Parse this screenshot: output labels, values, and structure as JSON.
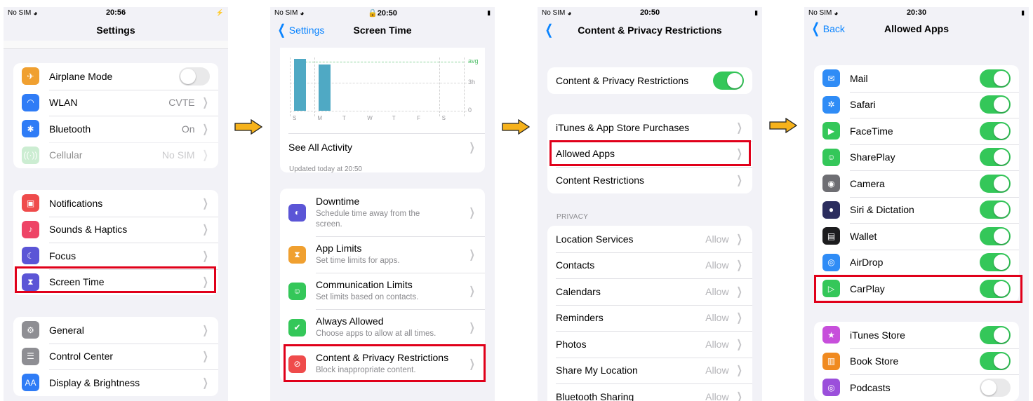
{
  "colors": {
    "accent": "#0a84ff",
    "toggle_on": "#34c759",
    "highlight": "#e0001a",
    "arrow": "#f6b21b",
    "bar": "#4fa9c4"
  },
  "settings": {
    "status": {
      "carrier": "No SIM",
      "time": "20:56",
      "battery": "⚡"
    },
    "title": "Settings",
    "group1": [
      {
        "icon": "airplane-icon",
        "glyph": "✈",
        "color": "#f0a030",
        "label": "Airplane Mode",
        "toggle": false
      },
      {
        "icon": "wifi-icon",
        "glyph": "◠",
        "color": "#2f7cf6",
        "label": "WLAN",
        "value": "CVTE"
      },
      {
        "icon": "bluetooth-icon",
        "glyph": "✱",
        "color": "#2f7cf6",
        "label": "Bluetooth",
        "value": "On"
      },
      {
        "icon": "cellular-icon",
        "glyph": "((·))",
        "color": "#8fd79b",
        "label": "Cellular",
        "value": "No SIM",
        "dimmed": true
      }
    ],
    "group2": [
      {
        "icon": "notifications-icon",
        "glyph": "▣",
        "color": "#ef4b4b",
        "label": "Notifications"
      },
      {
        "icon": "sounds-icon",
        "glyph": "♪",
        "color": "#ee4466",
        "label": "Sounds & Haptics"
      },
      {
        "icon": "focus-icon",
        "glyph": "☾",
        "color": "#5b55d6",
        "label": "Focus"
      },
      {
        "icon": "hourglass-icon",
        "glyph": "⧗",
        "color": "#5b55d6",
        "label": "Screen Time"
      }
    ],
    "group3": [
      {
        "icon": "gear-icon",
        "glyph": "⚙",
        "color": "#8e8e93",
        "label": "General"
      },
      {
        "icon": "control-center-icon",
        "glyph": "☰",
        "color": "#8e8e93",
        "label": "Control Center"
      },
      {
        "icon": "display-icon",
        "glyph": "AA",
        "color": "#2f7cf6",
        "label": "Display & Brightness"
      }
    ]
  },
  "screen_time": {
    "status": {
      "carrier": "No SIM",
      "time": "20:50",
      "battery": "▮"
    },
    "back": "Settings",
    "title": "Screen Time",
    "chart": {
      "y_ticks": [
        "avg",
        "3h",
        "0"
      ],
      "days": [
        "S",
        "M",
        "T",
        "W",
        "T",
        "F",
        "S"
      ],
      "bar_values_fraction": [
        0.98,
        0.87,
        0,
        0,
        0,
        0,
        0
      ]
    },
    "see_all": "See All Activity",
    "updated": "Updated today at 20:50",
    "items": [
      {
        "icon": "downtime-icon",
        "glyph": "◐",
        "color": "#5b55d6",
        "title": "Downtime",
        "sub": "Schedule time away from the screen."
      },
      {
        "icon": "app-limits-icon",
        "glyph": "⧗",
        "color": "#f0a030",
        "title": "App Limits",
        "sub": "Set time limits for apps."
      },
      {
        "icon": "communication-limits-icon",
        "glyph": "☺",
        "color": "#34c759",
        "title": "Communication Limits",
        "sub": "Set limits based on contacts."
      },
      {
        "icon": "always-allowed-icon",
        "glyph": "✔",
        "color": "#34c759",
        "title": "Always Allowed",
        "sub": "Choose apps to allow at all times."
      },
      {
        "icon": "restrictions-icon",
        "glyph": "⊘",
        "color": "#ef4b4b",
        "title": "Content & Privacy Restrictions",
        "sub": "Block inappropriate content."
      }
    ]
  },
  "restrictions": {
    "status": {
      "carrier": "No SIM",
      "time": "20:50",
      "battery": "▮"
    },
    "title": "Content & Privacy Restrictions",
    "master_toggle": {
      "label": "Content & Privacy Restrictions",
      "on": true
    },
    "group": [
      "iTunes & App Store Purchases",
      "Allowed Apps",
      "Content Restrictions"
    ],
    "privacy_header": "PRIVACY",
    "privacy": [
      {
        "label": "Location Services",
        "value": "Allow"
      },
      {
        "label": "Contacts",
        "value": "Allow"
      },
      {
        "label": "Calendars",
        "value": "Allow"
      },
      {
        "label": "Reminders",
        "value": "Allow"
      },
      {
        "label": "Photos",
        "value": "Allow"
      },
      {
        "label": "Share My Location",
        "value": "Allow"
      },
      {
        "label": "Bluetooth Sharing",
        "value": "Allow"
      }
    ]
  },
  "allowed_apps": {
    "status": {
      "carrier": "No SIM",
      "time": "20:30",
      "battery": "▮"
    },
    "back": "Back",
    "title": "Allowed Apps",
    "group1": [
      {
        "icon": "mail-icon",
        "glyph": "✉",
        "color": "#2f8cf6",
        "label": "Mail",
        "on": true
      },
      {
        "icon": "safari-icon",
        "glyph": "✲",
        "color": "#2f8cf6",
        "label": "Safari",
        "on": true
      },
      {
        "icon": "facetime-icon",
        "glyph": "▶",
        "color": "#34c759",
        "label": "FaceTime",
        "on": true
      },
      {
        "icon": "shareplay-icon",
        "glyph": "☺",
        "color": "#34c759",
        "label": "SharePlay",
        "on": true
      },
      {
        "icon": "camera-icon",
        "glyph": "◉",
        "color": "#6e6e73",
        "label": "Camera",
        "on": true
      },
      {
        "icon": "siri-icon",
        "glyph": "●",
        "color": "#2b2d5e",
        "label": "Siri & Dictation",
        "on": true
      },
      {
        "icon": "wallet-icon",
        "glyph": "▤",
        "color": "#1c1c1e",
        "label": "Wallet",
        "on": true
      },
      {
        "icon": "airdrop-icon",
        "glyph": "◎",
        "color": "#2f8cf6",
        "label": "AirDrop",
        "on": true
      },
      {
        "icon": "carplay-icon",
        "glyph": "▷",
        "color": "#34c759",
        "label": "CarPlay",
        "on": true
      }
    ],
    "group2": [
      {
        "icon": "itunes-store-icon",
        "glyph": "★",
        "color": "#c74fdb",
        "label": "iTunes Store",
        "on": true
      },
      {
        "icon": "book-store-icon",
        "glyph": "▥",
        "color": "#f08a20",
        "label": "Book Store",
        "on": true
      },
      {
        "icon": "podcasts-icon",
        "glyph": "◎",
        "color": "#9b4fdb",
        "label": "Podcasts",
        "on": false
      }
    ]
  }
}
